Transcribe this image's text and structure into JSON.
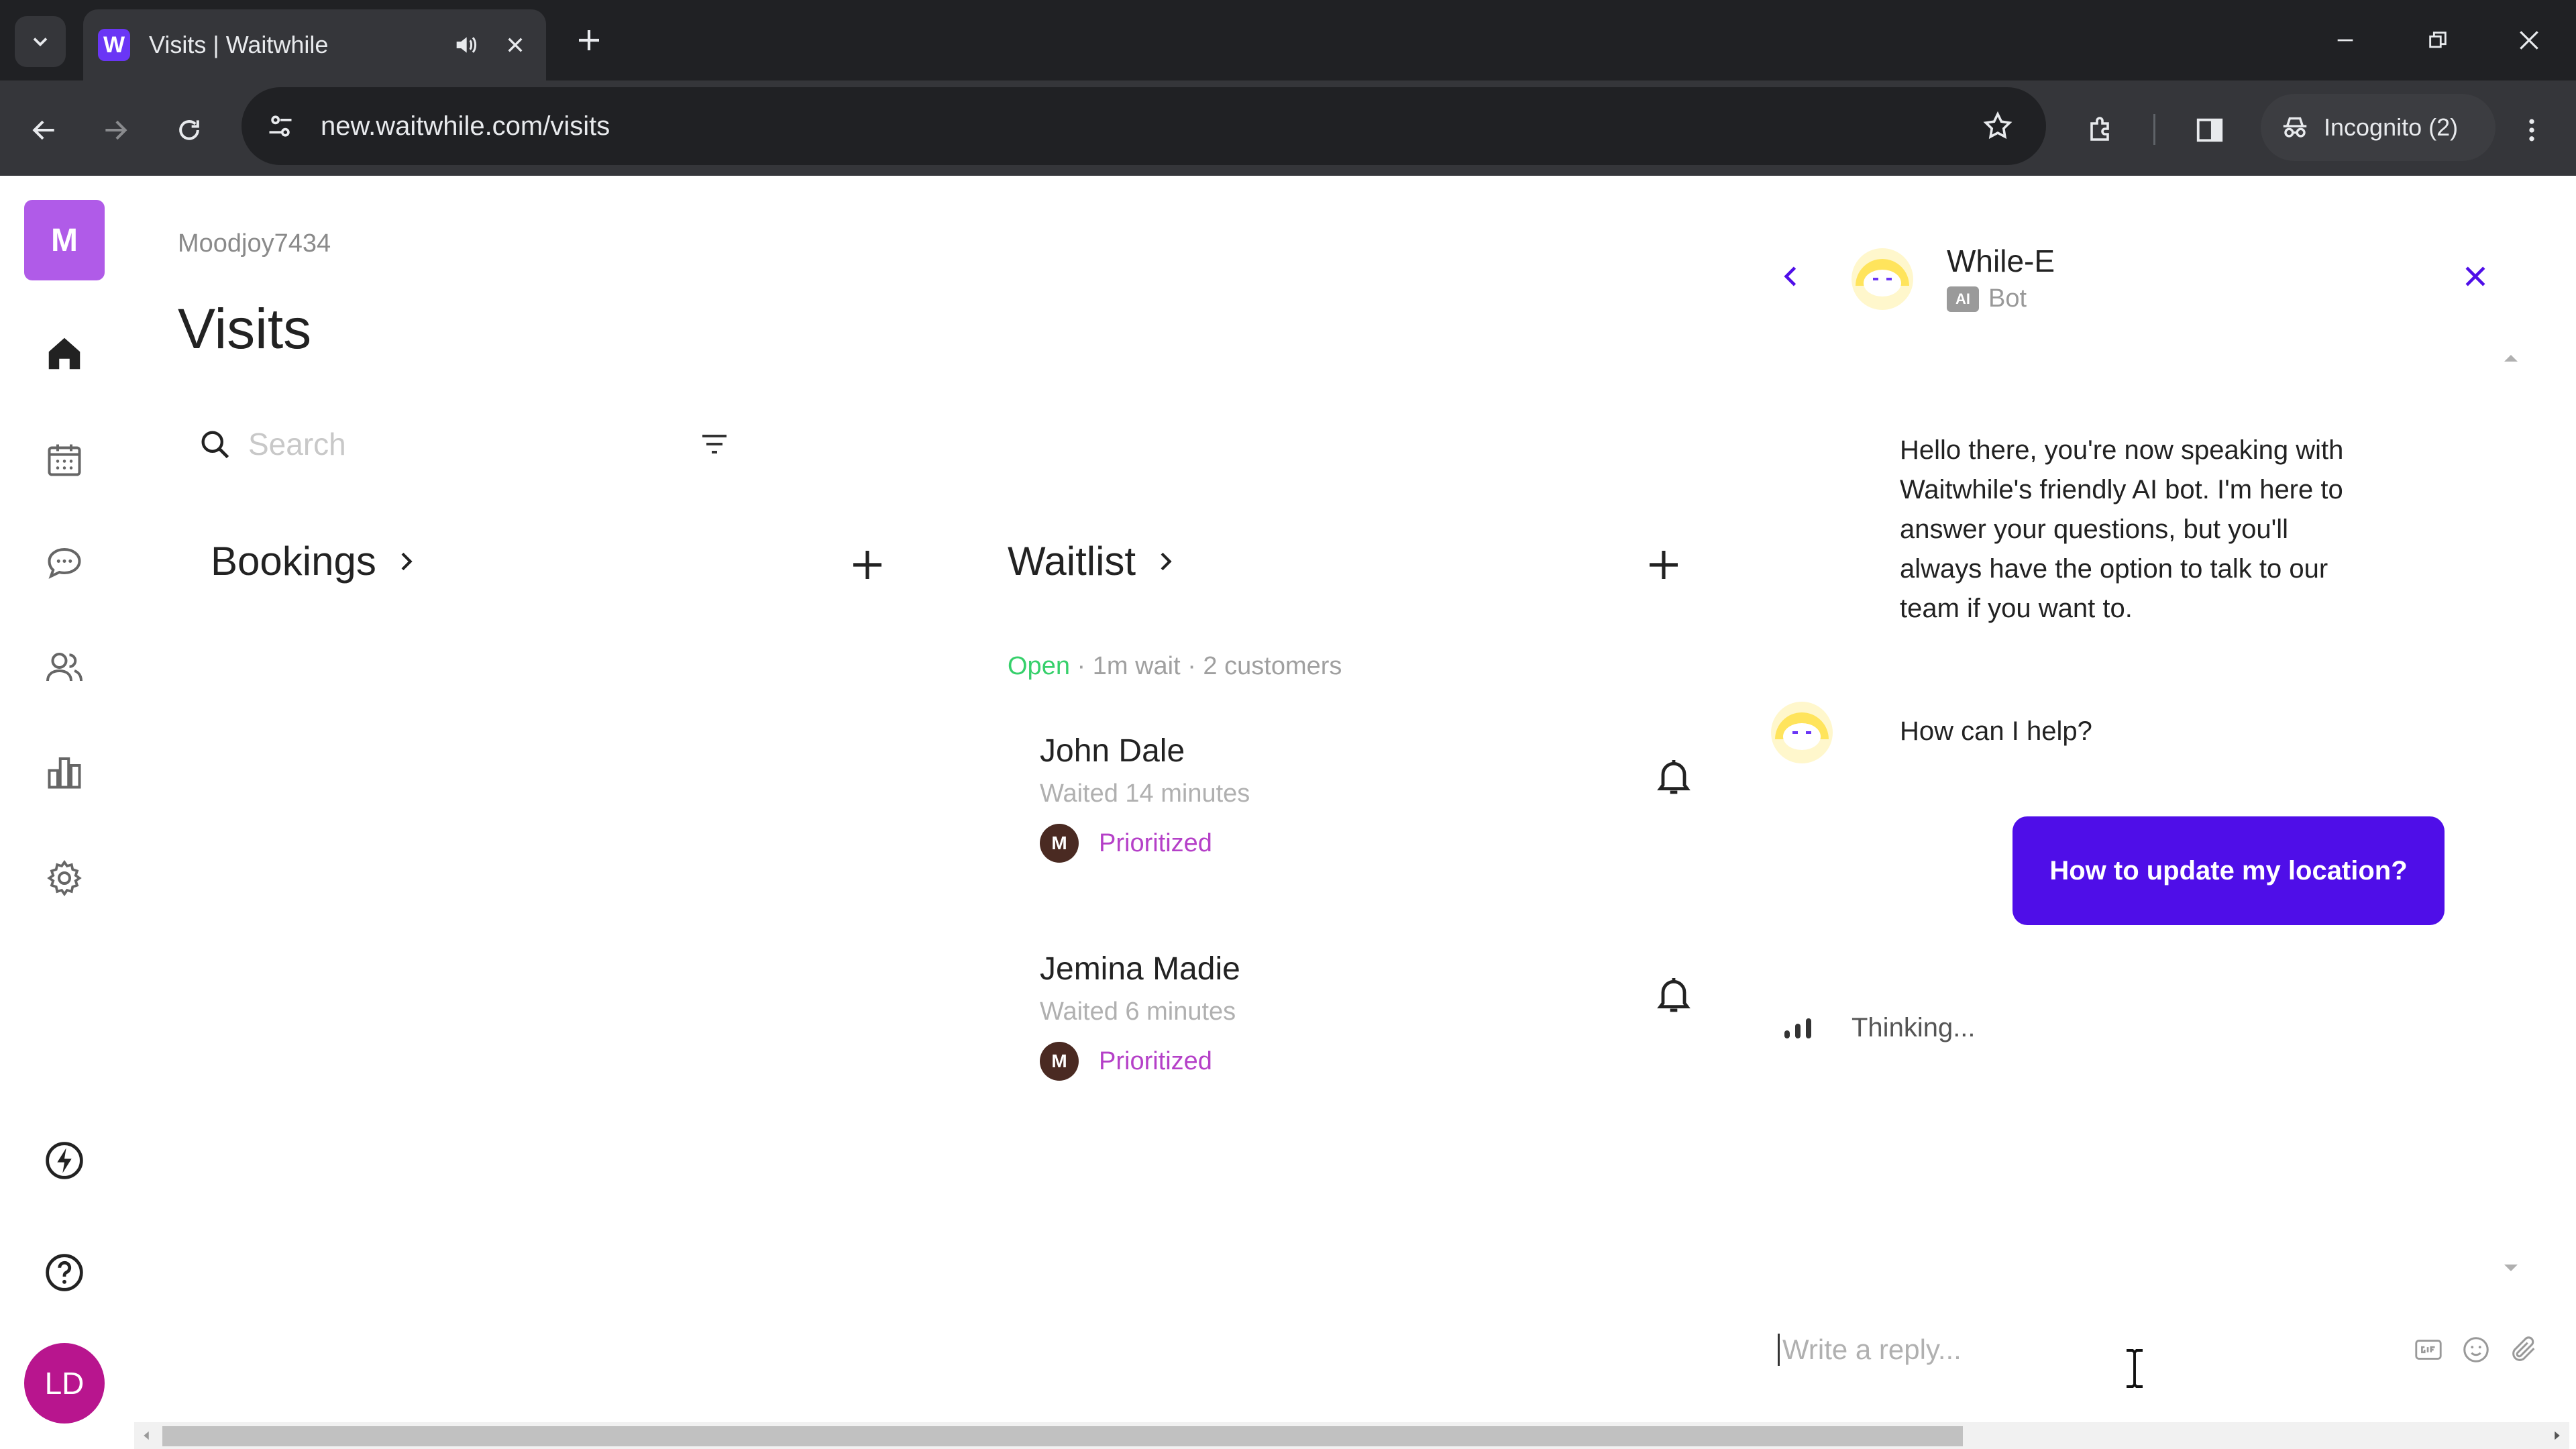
{
  "browser": {
    "tab_title": "Visits | Waitwhile",
    "favicon_letter": "W",
    "url": "new.waitwhile.com/visits",
    "incognito_label": "Incognito (2)"
  },
  "nav": {
    "org_initial": "M",
    "user_initials": "LD",
    "icons": [
      "home-icon",
      "calendar-icon",
      "chat-icon",
      "customers-icon",
      "analytics-icon",
      "settings-icon",
      "lightning-icon",
      "help-icon"
    ]
  },
  "main": {
    "account_name": "Moodjoy7434",
    "title": "Visits",
    "search_placeholder": "Search",
    "bookings_label": "Bookings",
    "waitlist_label": "Waitlist",
    "waitlist_status": {
      "open": "Open",
      "rest": " · 1m wait · 2 customers"
    },
    "customers": [
      {
        "name": "John Dale",
        "waited": "Waited 14 minutes",
        "tag_initial": "M",
        "tag": "Prioritized"
      },
      {
        "name": "Jemina Madie",
        "waited": "Waited 6 minutes",
        "tag_initial": "M",
        "tag": "Prioritized"
      }
    ]
  },
  "chat": {
    "bot_name": "While-E",
    "bot_badge": "AI",
    "bot_role": "Bot",
    "messages": {
      "intro": "Hello there, you're now speaking with Waitwhile's friendly AI bot. I'm here to answer your questions, but you'll always have the option to talk to our team if you want to.",
      "prompt": "How can I help?",
      "user": "How to update my location?",
      "status": "Thinking..."
    },
    "reply_placeholder": "Write a reply...",
    "tools": [
      "gif-icon",
      "emoji-icon",
      "attachment-icon"
    ]
  },
  "colors": {
    "accent": "#4f0ee8",
    "org_avatar": "#b05be8",
    "user_avatar": "#b8158e",
    "check_green": "#22e05a",
    "status_open": "#36d06b",
    "prioritized": "#b540c8"
  }
}
